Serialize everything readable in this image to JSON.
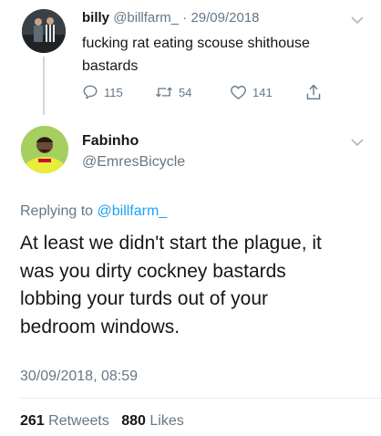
{
  "parent_tweet": {
    "display_name": "billy",
    "handle": "@billfarm_",
    "separator": "·",
    "date": "29/09/2018",
    "text_line1": "fucking rat eating scouse shithouse",
    "text_line2": "bastards",
    "replies": "115",
    "retweets": "54",
    "likes": "141"
  },
  "main_tweet": {
    "display_name": "Fabinho",
    "handle": "@EmresBicycle",
    "replying_prefix": "Replying to",
    "replying_handle": "@billfarm_",
    "text_lines": [
      "At least we didn't start the plague, it",
      "was you dirty cockney bastards",
      "lobbing your turds out of your",
      "bedroom windows."
    ],
    "timestamp": "30/09/2018, 08:59",
    "retweet_count": "261",
    "retweet_label": "Retweets",
    "like_count": "880",
    "like_label": "Likes"
  },
  "colors": {
    "link": "#1da1f2",
    "muted": "#657786",
    "thread_line": "#ccd6dd",
    "divider": "#e6ecf0"
  },
  "icons": [
    "reply-icon",
    "retweet-icon",
    "like-icon",
    "share-icon",
    "chevron-down-icon"
  ]
}
